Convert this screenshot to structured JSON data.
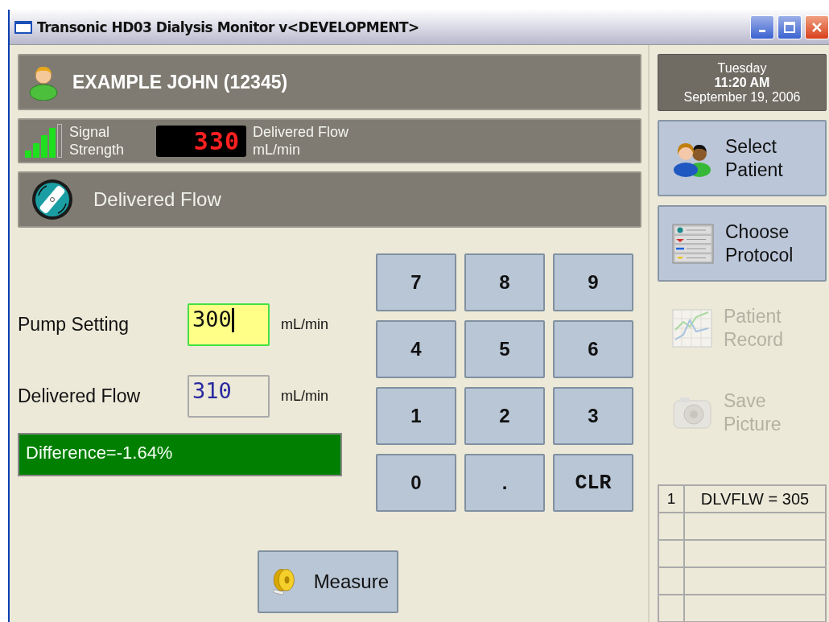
{
  "window": {
    "title": "Transonic HD03 Dialysis Monitor v<DEVELOPMENT>"
  },
  "patient": {
    "name": "EXAMPLE JOHN (12345)"
  },
  "signal": {
    "label_lines": [
      "Signal",
      "Strength"
    ],
    "display": "330",
    "display_label_lines": [
      "Delivered Flow",
      "mL/min"
    ]
  },
  "mode": {
    "title": "Delivered Flow"
  },
  "fields": [
    {
      "label": "Pump Setting",
      "value": "300",
      "unit": "mL/min",
      "focused": true
    },
    {
      "label": "Delivered Flow",
      "value": "310",
      "unit": "mL/min",
      "focused": false
    }
  ],
  "difference": "Difference=-1.64%",
  "keypad": [
    "7",
    "8",
    "9",
    "4",
    "5",
    "6",
    "1",
    "2",
    "3",
    "0",
    ".",
    "CLR"
  ],
  "measure_button": "Measure",
  "clock": {
    "day": "Tuesday",
    "time": "11:20 AM",
    "date": "September 19, 2006"
  },
  "actions": [
    {
      "kind": "patients",
      "label_lines": [
        "Select",
        "Patient"
      ],
      "disabled": false
    },
    {
      "kind": "protocol",
      "label_lines": [
        "Choose",
        "Protocol"
      ],
      "disabled": false
    },
    {
      "kind": "record",
      "label_lines": [
        "Patient",
        "Record"
      ],
      "disabled": true
    },
    {
      "kind": "camera",
      "label_lines": [
        "Save",
        "Picture"
      ],
      "disabled": true
    }
  ],
  "log": {
    "rows": [
      {
        "index": "1",
        "entry": "DLVFLW = 305"
      }
    ]
  }
}
